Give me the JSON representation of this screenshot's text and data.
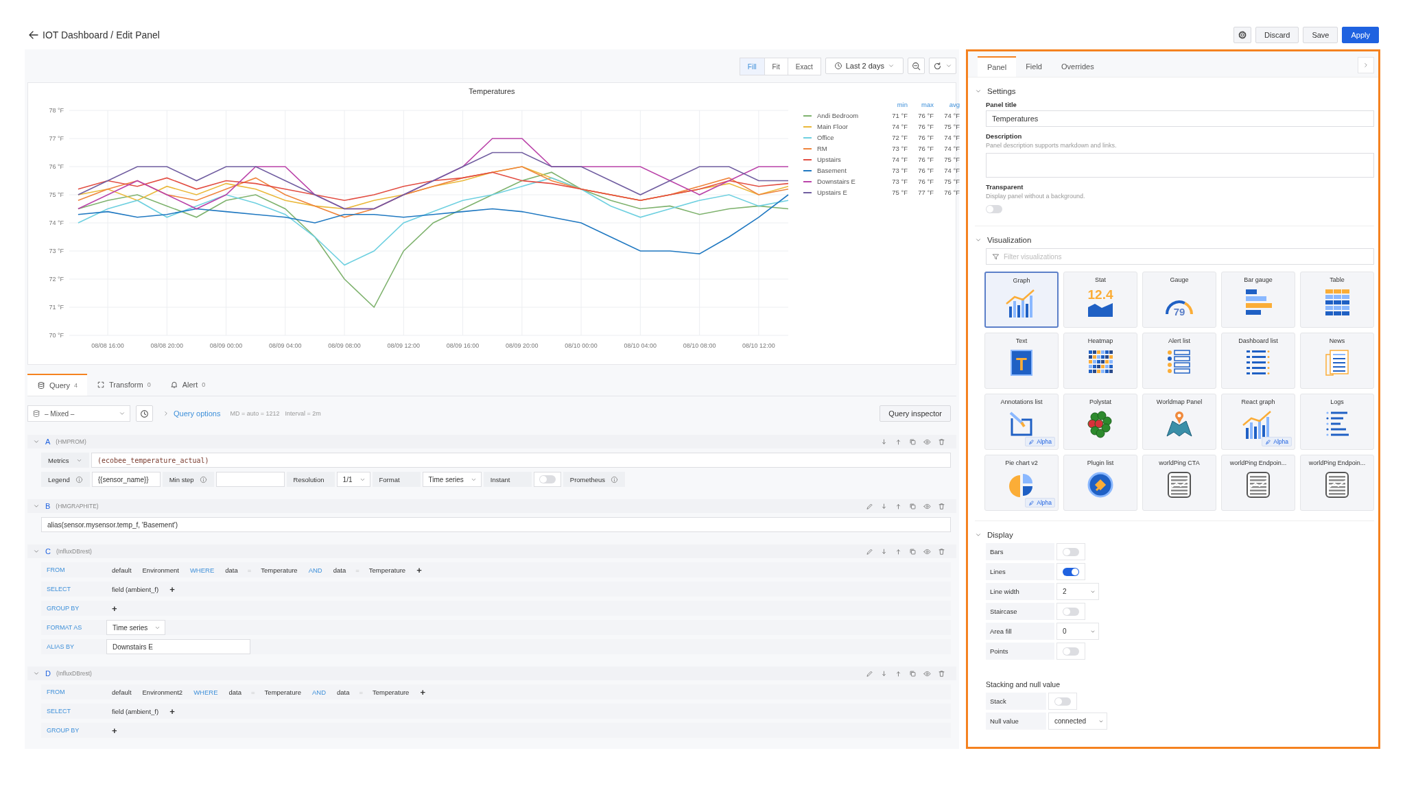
{
  "header": {
    "title": "IOT Dashboard / Edit Panel",
    "buttons": [
      {
        "label": "Discard",
        "kind": "secondary"
      },
      {
        "label": "Save",
        "kind": "secondary"
      },
      {
        "label": "Apply",
        "kind": "primary"
      }
    ]
  },
  "toolbar": {
    "modes": [
      {
        "label": "Fill",
        "selected": true
      },
      {
        "label": "Fit",
        "selected": false
      },
      {
        "label": "Exact",
        "selected": false
      }
    ],
    "time_range": "Last 2 days"
  },
  "panel": {
    "title": "Temperatures",
    "chart_data": {
      "type": "line",
      "categories": [
        null,
        "08/08 16:00",
        null,
        "08/08 20:00",
        null,
        "08/09 00:00",
        null,
        "08/09 04:00",
        null,
        "08/09 08:00",
        null,
        "08/09 12:00",
        null,
        "08/09 16:00",
        null,
        "08/09 20:00",
        null,
        "08/10 00:00",
        null,
        "08/10 04:00",
        null,
        "08/10 08:00",
        null,
        "08/10 12:00",
        null
      ],
      "ylim": [
        70,
        78
      ],
      "grid": true,
      "yticks": [
        {
          "value": 78,
          "label": "78 °F"
        },
        {
          "value": 77,
          "label": "77 °F"
        },
        {
          "value": 76,
          "label": "76 °F"
        },
        {
          "value": 75,
          "label": "75 °F"
        },
        {
          "value": 74,
          "label": "74 °F"
        },
        {
          "value": 73,
          "label": "73 °F"
        },
        {
          "value": 72,
          "label": "72 °F"
        },
        {
          "value": 71,
          "label": "71 °F"
        },
        {
          "value": 70,
          "label": "70 °F"
        }
      ],
      "series": [
        {
          "name": "Andi Bedroom",
          "color": "#7eb26d",
          "values": [
            74.5,
            74.8,
            75,
            74.6,
            74.2,
            74.8,
            75,
            74.5,
            73.5,
            72,
            71,
            73,
            74,
            74.5,
            75,
            75.5,
            75.8,
            75.2,
            74.8,
            74.5,
            74.6,
            74.3,
            74.5,
            74.6,
            74.5
          ]
        },
        {
          "name": "Main Floor",
          "color": "#eab839",
          "values": [
            75,
            75.2,
            74.8,
            75.3,
            75,
            75.4,
            75.2,
            74.8,
            74.6,
            74.5,
            74.8,
            75,
            75.3,
            75.5,
            75.8,
            76,
            75.6,
            75.2,
            75,
            74.8,
            75,
            75.2,
            75.4,
            75,
            75.3
          ]
        },
        {
          "name": "Office",
          "color": "#6ed0e0",
          "values": [
            74,
            74.5,
            74.8,
            74.2,
            74.6,
            75,
            74.7,
            74.3,
            73.5,
            72.5,
            73,
            74,
            74.4,
            74.8,
            75,
            75.3,
            75.6,
            75.2,
            74.6,
            74.2,
            74.5,
            74.8,
            75,
            74.6,
            74.8
          ]
        },
        {
          "name": "RM",
          "color": "#ef843c",
          "values": [
            74.8,
            75.2,
            75.5,
            75,
            74.8,
            75.2,
            75.6,
            75,
            74.6,
            74.2,
            74.5,
            75,
            75.3,
            75.6,
            75.8,
            76,
            75.5,
            75.2,
            75,
            74.8,
            75,
            75.3,
            75.6,
            75,
            75.2
          ]
        },
        {
          "name": "Upstairs",
          "color": "#e24d42",
          "values": [
            75.2,
            75.5,
            75.3,
            75.6,
            75.2,
            75.5,
            75.4,
            75.2,
            75,
            74.8,
            75,
            75.3,
            75.5,
            75.6,
            75.8,
            75.5,
            75.4,
            75.2,
            75,
            74.8,
            75,
            75.2,
            75.5,
            75.3,
            75.4
          ]
        },
        {
          "name": "Basement",
          "color": "#1f78c1",
          "values": [
            74.3,
            74.4,
            74.2,
            74.3,
            74.5,
            74.4,
            74.3,
            74.2,
            74,
            74.3,
            74.3,
            74.2,
            74.3,
            74.4,
            74.5,
            74.4,
            74.2,
            74,
            73.5,
            73,
            73,
            72.9,
            73.5,
            74.2,
            75
          ]
        },
        {
          "name": "Downstairs E",
          "color": "#ba43a9",
          "values": [
            74.5,
            75,
            75.5,
            75,
            74.5,
            75,
            76,
            76,
            75,
            74.5,
            74.5,
            75,
            75.5,
            76,
            77,
            77,
            76,
            76,
            76,
            76,
            75.5,
            75,
            75.5,
            76,
            76
          ]
        },
        {
          "name": "Upstairs E",
          "color": "#705da0",
          "values": [
            75,
            75.5,
            76,
            76,
            75.5,
            76,
            76,
            75.5,
            75,
            74.5,
            74.5,
            75,
            75.5,
            76,
            76.5,
            76.5,
            76,
            76,
            75.5,
            75,
            75.5,
            76,
            76,
            75.5,
            75.5
          ]
        }
      ]
    },
    "legend": {
      "columns": [
        "min",
        "max",
        "avg"
      ],
      "rows": [
        [
          "71 °F",
          "76 °F",
          "74 °F"
        ],
        [
          "74 °F",
          "76 °F",
          "75 °F"
        ],
        [
          "72 °F",
          "76 °F",
          "74 °F"
        ],
        [
          "73 °F",
          "76 °F",
          "74 °F"
        ],
        [
          "74 °F",
          "76 °F",
          "75 °F"
        ],
        [
          "73 °F",
          "76 °F",
          "74 °F"
        ],
        [
          "73 °F",
          "76 °F",
          "75 °F"
        ],
        [
          "75 °F",
          "77 °F",
          "76 °F"
        ]
      ]
    }
  },
  "query_tabs": [
    {
      "label": "Query",
      "count": "4",
      "kind": "query",
      "selected": true
    },
    {
      "label": "Transform",
      "count": "0",
      "kind": "transform",
      "selected": false
    },
    {
      "label": "Alert",
      "count": "0",
      "kind": "alert",
      "selected": false
    }
  ],
  "query_options": {
    "datasource": "– Mixed –",
    "link": "Query options",
    "max_data_points": "MD = auto = 1212",
    "interval": "Interval = 2m",
    "inspector": "Query inspector"
  },
  "queries": [
    {
      "letter": "A",
      "source": "(HMPROM)",
      "kind": "prometheus",
      "rows": [
        [
          {
            "kind": "dropdown",
            "text": "Metrics"
          },
          {
            "kind": "code",
            "text": "(ecobee_temperature_actual)"
          }
        ],
        [
          {
            "kind": "label",
            "text": "Legend",
            "info": true
          },
          {
            "kind": "input",
            "text": "{{sensor_name}}"
          },
          {
            "kind": "label",
            "text": "Min step",
            "info": true
          },
          {
            "kind": "input"
          },
          {
            "kind": "label",
            "text": "Resolution"
          },
          {
            "kind": "select",
            "text": "1/1"
          },
          {
            "kind": "label",
            "text": "Format"
          },
          {
            "kind": "select",
            "text": "Time series"
          },
          {
            "kind": "label",
            "text": "Instant"
          },
          {
            "kind": "toggle",
            "on": false
          },
          {
            "kind": "label",
            "text": "Prometheus",
            "info": true
          }
        ]
      ]
    },
    {
      "letter": "B",
      "source": "(HMGRAPHITE)",
      "kind": "graphite",
      "rows": [
        [
          {
            "kind": "expression",
            "text": "alias(sensor.mysensor.temp_f, 'Basement')"
          }
        ]
      ]
    },
    {
      "letter": "C",
      "source": "(InfluxDBrest)",
      "kind": "influx",
      "rows": [
        [
          {
            "kind": "keyword",
            "text": "FROM"
          },
          {
            "kind": "segment",
            "text": "default"
          },
          {
            "kind": "segment",
            "text": "Environment"
          },
          {
            "kind": "operator",
            "text": "WHERE"
          },
          {
            "kind": "segment",
            "text": "data"
          },
          {
            "kind": "equals",
            "text": "="
          },
          {
            "kind": "segment",
            "text": "Temperature"
          },
          {
            "kind": "operator",
            "text": "AND"
          },
          {
            "kind": "segment",
            "text": "data"
          },
          {
            "kind": "equals",
            "text": "="
          },
          {
            "kind": "segment",
            "text": "Temperature"
          },
          {
            "kind": "add",
            "text": "+"
          }
        ],
        [
          {
            "kind": "keyword",
            "text": "SELECT"
          },
          {
            "kind": "segment",
            "text": "field (ambient_f)"
          },
          {
            "kind": "add",
            "text": "+"
          }
        ],
        [
          {
            "kind": "keyword",
            "text": "GROUP BY"
          },
          {
            "kind": "add",
            "text": "+"
          }
        ],
        [
          {
            "kind": "keyword",
            "text": "FORMAT AS"
          },
          {
            "kind": "select",
            "text": "Time series"
          }
        ],
        [
          {
            "kind": "keyword",
            "text": "ALIAS BY"
          },
          {
            "kind": "input",
            "text": "Downstairs E"
          }
        ]
      ]
    },
    {
      "letter": "D",
      "source": "(InfluxDBrest)",
      "kind": "influx",
      "rows": [
        [
          {
            "kind": "keyword",
            "text": "FROM"
          },
          {
            "kind": "segment",
            "text": "default"
          },
          {
            "kind": "segment",
            "text": "Environment2"
          },
          {
            "kind": "operator",
            "text": "WHERE"
          },
          {
            "kind": "segment",
            "text": "data"
          },
          {
            "kind": "equals",
            "text": "="
          },
          {
            "kind": "segment",
            "text": "Temperature"
          },
          {
            "kind": "operator",
            "text": "AND"
          },
          {
            "kind": "segment",
            "text": "data"
          },
          {
            "kind": "equals",
            "text": "="
          },
          {
            "kind": "segment",
            "text": "Temperature"
          },
          {
            "kind": "add",
            "text": "+"
          }
        ],
        [
          {
            "kind": "keyword",
            "text": "SELECT"
          },
          {
            "kind": "segment",
            "text": "field (ambient_f)"
          },
          {
            "kind": "add",
            "text": "+"
          }
        ],
        [
          {
            "kind": "keyword",
            "text": "GROUP BY"
          },
          {
            "kind": "add",
            "text": "+"
          }
        ]
      ]
    }
  ],
  "options_pane": {
    "tabs": [
      {
        "label": "Panel",
        "selected": true
      },
      {
        "label": "Field",
        "selected": false
      },
      {
        "label": "Overrides",
        "selected": false
      }
    ],
    "settings": {
      "title": "Settings",
      "panel_title_label": "Panel title",
      "panel_title": "Temperatures",
      "description_label": "Description",
      "description_help": "Panel description supports markdown and links.",
      "transparent_label": "Transparent",
      "transparent_help": "Display panel without a background.",
      "transparent": false
    },
    "visualization": {
      "title": "Visualization",
      "filter_placeholder": "Filter visualizations",
      "items": [
        {
          "name": "Graph",
          "kind": "graph",
          "selected": true
        },
        {
          "name": "Stat",
          "kind": "stat",
          "icon_text": "12.4",
          "selected": false
        },
        {
          "name": "Gauge",
          "kind": "gauge",
          "icon_text": "79",
          "selected": false
        },
        {
          "name": "Bar gauge",
          "kind": "bargauge",
          "selected": false
        },
        {
          "name": "Table",
          "kind": "table",
          "selected": false
        },
        {
          "name": "Text",
          "kind": "text",
          "icon_text": "T",
          "selected": false
        },
        {
          "name": "Heatmap",
          "kind": "heatmap",
          "selected": false
        },
        {
          "name": "Alert list",
          "kind": "alertlist",
          "selected": false
        },
        {
          "name": "Dashboard list",
          "kind": "dashlist",
          "selected": false
        },
        {
          "name": "News",
          "kind": "news",
          "selected": false
        },
        {
          "name": "Annotations list",
          "kind": "annolist",
          "badge": "Alpha",
          "selected": false
        },
        {
          "name": "Polystat",
          "kind": "polystat",
          "selected": false
        },
        {
          "name": "Worldmap Panel",
          "kind": "worldmap",
          "selected": false
        },
        {
          "name": "React graph",
          "kind": "graph",
          "badge": "Alpha",
          "selected": false
        },
        {
          "name": "Logs",
          "kind": "logs",
          "selected": false
        },
        {
          "name": "Pie chart v2",
          "kind": "pie",
          "badge": "Alpha",
          "selected": false
        },
        {
          "name": "Plugin list",
          "kind": "plugins",
          "selected": false
        },
        {
          "name": "worldPing CTA",
          "kind": "worldping",
          "selected": false
        },
        {
          "name": "worldPing Endpoin...",
          "kind": "worldping",
          "selected": false
        },
        {
          "name": "worldPing Endpoin...",
          "kind": "worldping",
          "selected": false
        }
      ]
    },
    "display": {
      "title": "Display",
      "options": [
        {
          "label": "Bars",
          "kind": "toggle",
          "on": false
        },
        {
          "label": "Lines",
          "kind": "toggle",
          "on": true
        },
        {
          "label": "Line width",
          "kind": "select",
          "value": "2"
        },
        {
          "label": "Staircase",
          "kind": "toggle",
          "on": false
        },
        {
          "label": "Area fill",
          "kind": "select",
          "value": "0"
        },
        {
          "label": "Points",
          "kind": "toggle",
          "on": false
        }
      ],
      "stacking_title": "Stacking and null value",
      "stacking_options": [
        {
          "label": "Stack",
          "kind": "toggle",
          "on": false
        },
        {
          "label": "Null value",
          "kind": "select",
          "value": "connected"
        }
      ]
    }
  }
}
